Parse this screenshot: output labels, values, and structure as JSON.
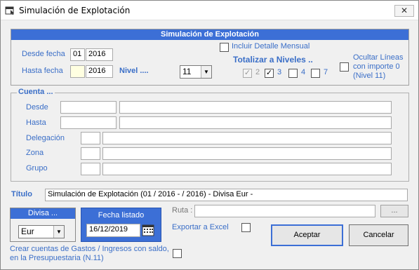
{
  "window": {
    "title": "Simulación de Explotación",
    "close_symbol": "✕"
  },
  "top_panel": {
    "header": "Simulación de Explotación",
    "desde_fecha_label": "Desde fecha",
    "desde_mes": "01",
    "desde_anio": "2016",
    "hasta_fecha_label": "Hasta fecha",
    "hasta_mes": "",
    "hasta_anio": "2016",
    "nivel_label": "Nivel ....",
    "nivel_value": "11",
    "incluir_detalle_label": "Incluir Detalle Mensual",
    "incluir_detalle_checked": false,
    "totalizar_label": "Totalizar a Niveles ..",
    "niveles": [
      {
        "label": "2",
        "checked": true,
        "disabled": true,
        "mark": "✓"
      },
      {
        "label": "3",
        "checked": true,
        "disabled": false,
        "mark": "✓"
      },
      {
        "label": "4",
        "checked": false,
        "disabled": false,
        "mark": ""
      },
      {
        "label": "7",
        "checked": false,
        "disabled": false,
        "mark": ""
      }
    ],
    "ocultar_label_1": "Ocultar Líneas",
    "ocultar_label_2": "con importe 0",
    "ocultar_label_3": "(Nivel 11)",
    "ocultar_checked": false
  },
  "cuenta": {
    "legend": "Cuenta ...",
    "desde_label": "Desde",
    "hasta_label": "Hasta",
    "delegacion_label": "Delegación",
    "zona_label": "Zona",
    "grupo_label": "Grupo"
  },
  "titulo": {
    "label": "Título",
    "value": "Simulación de Explotación (01 / 2016 -  / 2016)  - Divisa Eur -"
  },
  "divisa": {
    "header": "Divisa ...",
    "value": "Eur"
  },
  "fecha_listado": {
    "header": "Fecha listado",
    "value": "16/12/2019"
  },
  "ruta": {
    "label": "Ruta :",
    "value": "",
    "browse_label": "..."
  },
  "exportar": {
    "label": "Exportar a Excel",
    "checked": false
  },
  "crear_cuentas": {
    "label_1": "Crear cuentas de Gastos / Ingresos con saldo,",
    "label_2": "en la Presupuestaria (N.11)",
    "checked": false
  },
  "buttons": {
    "aceptar": "Aceptar",
    "cancelar": "Cancelar"
  },
  "colors": {
    "accent": "#3c6fd6",
    "label_blue": "#3a6ec7",
    "background": "#f0f0f0"
  }
}
